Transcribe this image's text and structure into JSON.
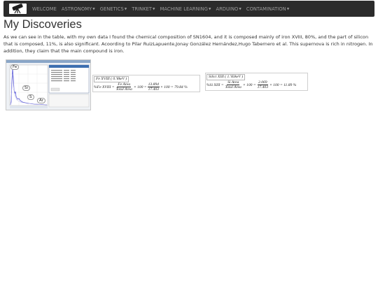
{
  "nav": {
    "brand_icon": "telescope-icon",
    "items": [
      {
        "label": "WELCOME",
        "dropdown": false
      },
      {
        "label": "ASTRONOMY",
        "dropdown": true
      },
      {
        "label": "GENETICS",
        "dropdown": true
      },
      {
        "label": "TRINKET",
        "dropdown": true
      },
      {
        "label": "MACHINE LEARNING",
        "dropdown": true
      },
      {
        "label": "ARDUINO",
        "dropdown": true
      },
      {
        "label": "CONTAMINATION",
        "dropdown": true
      }
    ]
  },
  "page": {
    "title": "My Discoveries",
    "intro": "As we can see in the table, with my own data I found the chemical composition of SN1604, and it is composed mainly of iron XVIII, 80%, and the part of silicon that is composed, 11%, is also significant. Acoording to Pilar RuizLapuente,Jonay González Hernández,Hugo Tabernero et al. This supernova is rich in nitrogen. In addition, they claim that the main compound is iron."
  },
  "spectrum": {
    "labels": [
      "Fe",
      "Si",
      "S",
      "Ar"
    ]
  },
  "formulas": [
    {
      "header": "Fe XVIII ( 0.'8keV )",
      "lhs": "%Fe XVIII =",
      "num": "Fe Area",
      "den": "Total Area",
      "mid": "× 100 =",
      "num2": "13.894",
      "den2": "17.403",
      "tail": "× 100 = 79.84 %"
    },
    {
      "header": "Silici XIII ( 1.'83keV )",
      "lhs": "%Si XIII =",
      "num": "Si Area",
      "den": "Total Area",
      "mid": "× 100 =",
      "num2": "2.069",
      "den2": "17.403",
      "tail": "× 100 = 11.89 %"
    }
  ]
}
